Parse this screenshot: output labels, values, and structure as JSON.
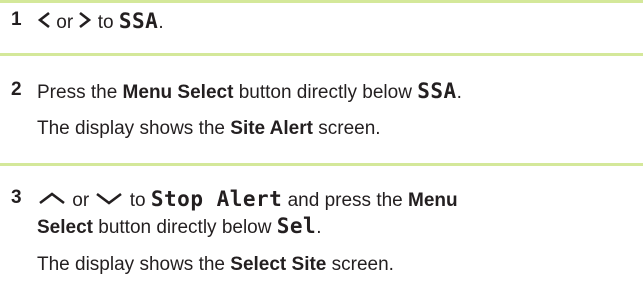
{
  "steps": [
    {
      "number": "1",
      "line1": {
        "prefix_icon": "chevron-left-icon",
        "or": "or",
        "suffix_icon": "chevron-right-icon",
        "to": "to",
        "target": "SSA",
        "end": "."
      }
    },
    {
      "number": "2",
      "line1": {
        "text1": "Press the ",
        "bold1": "Menu Select",
        "text2": " button directly below ",
        "target": "SSA",
        "end": "."
      },
      "line2": {
        "text1": "The display shows the ",
        "bold1": "Site Alert",
        "text2": " screen."
      }
    },
    {
      "number": "3",
      "line1": {
        "prefix_icon": "chevron-up-icon",
        "or": "or",
        "suffix_icon": "chevron-down-icon",
        "to": "to",
        "target": "Stop Alert",
        "text2": " and press the ",
        "bold1": "Menu"
      },
      "line2": {
        "bold1": "Select",
        "text1": " button directly below ",
        "target": "Sel",
        "end": "."
      },
      "line3": {
        "text1": "The display shows the ",
        "bold1": "Select Site",
        "text2": " screen."
      }
    }
  ],
  "colors": {
    "rule": "#d4e89a",
    "text": "#231f20"
  }
}
